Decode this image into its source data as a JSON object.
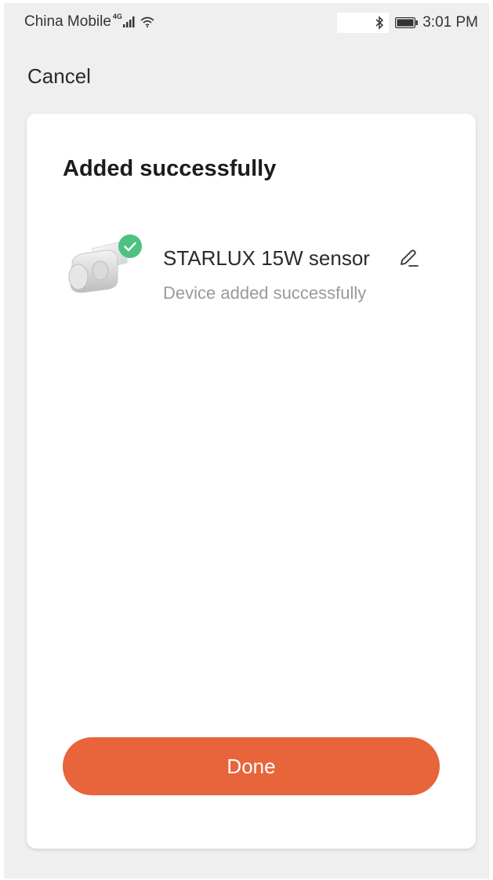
{
  "status_bar": {
    "carrier": "China Mobile",
    "network_type": "4G",
    "time": "3:01 PM",
    "icons": [
      "signal-icon",
      "wifi-icon",
      "bluetooth-icon",
      "battery-icon"
    ]
  },
  "nav": {
    "cancel_label": "Cancel"
  },
  "card": {
    "title": "Added successfully",
    "device": {
      "name": "STARLUX 15W sensor",
      "status": "Device added successfully",
      "image_icon": "motion-sensor-icon",
      "badge_icon": "check-icon",
      "edit_icon": "pencil-icon"
    },
    "done_label": "Done"
  },
  "colors": {
    "accent": "#e8643a",
    "success": "#4ec07f",
    "background": "#efefef",
    "card": "#ffffff"
  }
}
